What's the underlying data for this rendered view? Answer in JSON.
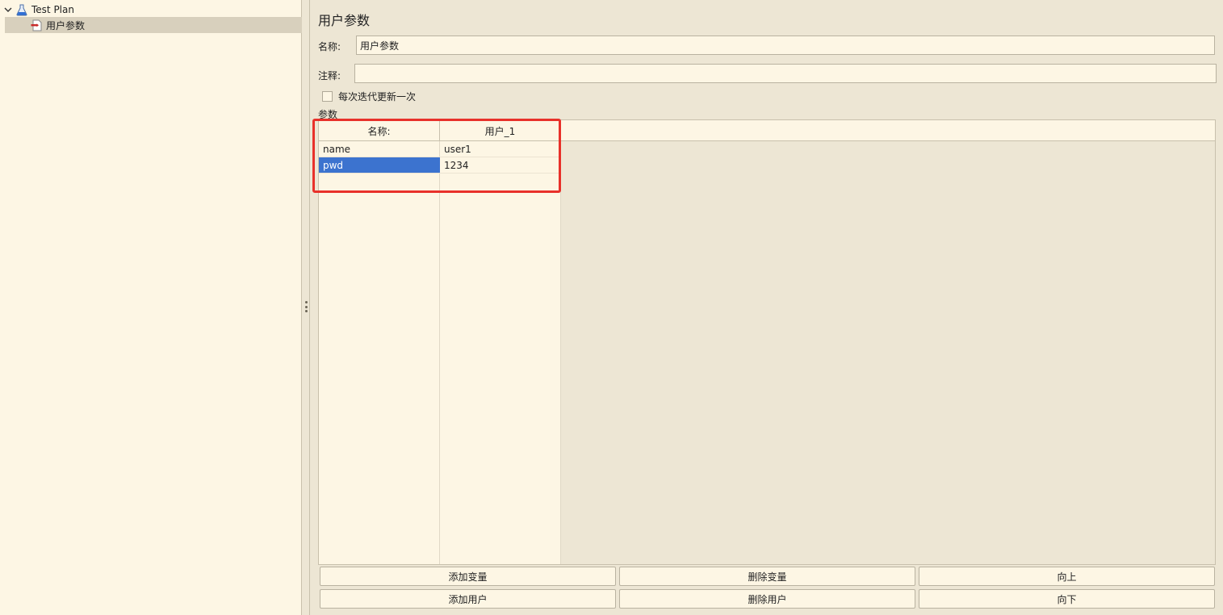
{
  "tree": {
    "root_label": "Test Plan",
    "child_label": "用户参数"
  },
  "panel": {
    "title": "用户参数",
    "name_label": "名称:",
    "name_value": "用户参数",
    "comment_label": "注释:",
    "comment_value": "",
    "checkbox_label": "每次迭代更新一次",
    "checkbox_checked": false,
    "params_label": "参数"
  },
  "table": {
    "columns": [
      "名称:",
      "用户_1"
    ],
    "rows": [
      {
        "name": "name",
        "value": "user1",
        "selected": false
      },
      {
        "name": "pwd",
        "value": "1234",
        "selected": true
      }
    ]
  },
  "buttons": {
    "add_variable": "添加变量",
    "delete_variable": "删除变量",
    "move_up": "向上",
    "add_user": "添加用户",
    "delete_user": "删除用户",
    "move_down": "向下"
  },
  "colors": {
    "selection": "#3c73cf",
    "highlight_annotation": "#e8312a",
    "pane_background": "#fdf6e4",
    "window_background": "#ede6d4"
  }
}
